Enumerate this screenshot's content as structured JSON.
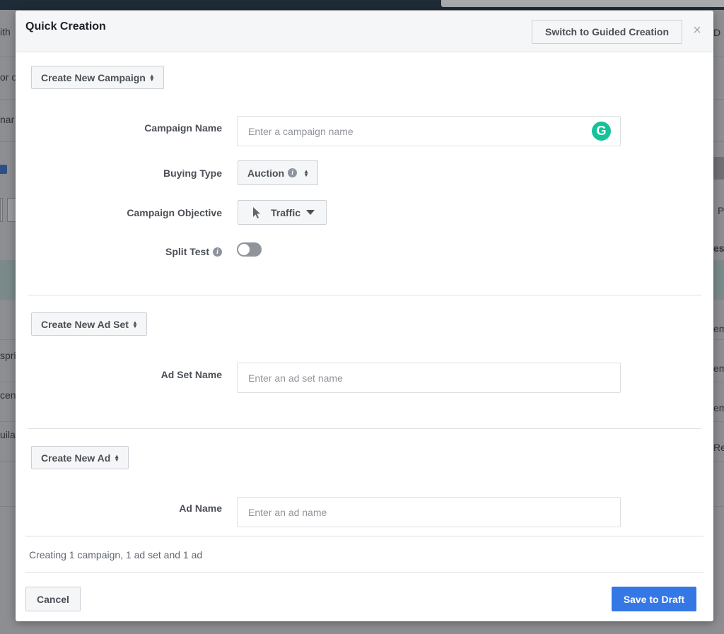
{
  "background": {
    "left_fragments": [
      {
        "text": "ith"
      },
      {
        "text": "or c"
      },
      {
        "text": "nar"
      },
      {
        "text": "spri"
      },
      {
        "text": "cen"
      },
      {
        "text": "uila"
      }
    ],
    "right_fragments": [
      {
        "text": "D"
      },
      {
        "text": "P"
      },
      {
        "text": "es"
      },
      {
        "text": "em"
      },
      {
        "text": "em"
      },
      {
        "text": "em"
      },
      {
        "text": "Re"
      }
    ]
  },
  "modal": {
    "title": "Quick Creation",
    "switch_button": "Switch to Guided Creation",
    "close_glyph": "×"
  },
  "campaign": {
    "level_button": "Create New Campaign",
    "name_label": "Campaign Name",
    "name_placeholder": "Enter a campaign name",
    "buying_type_label": "Buying Type",
    "buying_type_value": "Auction",
    "objective_label": "Campaign Objective",
    "objective_value": "Traffic",
    "split_test_label": "Split Test",
    "split_test_on": false
  },
  "ad_set": {
    "level_button": "Create New Ad Set",
    "name_label": "Ad Set Name",
    "name_placeholder": "Enter an ad set name"
  },
  "ad": {
    "level_button": "Create New Ad",
    "name_label": "Ad Name",
    "name_placeholder": "Enter an ad name"
  },
  "footer": {
    "summary": "Creating 1 campaign, 1 ad set and 1 ad",
    "cancel": "Cancel",
    "save": "Save to Draft"
  },
  "colors": {
    "primary": "#3578e5",
    "grammarly": "#15c39a",
    "overlay": "#8c8e91"
  },
  "icons": {
    "info": "info-icon",
    "cursor": "cursor-icon",
    "grammarly": "grammarly-icon",
    "updown": "sort-arrows-icon",
    "close": "close-icon"
  }
}
